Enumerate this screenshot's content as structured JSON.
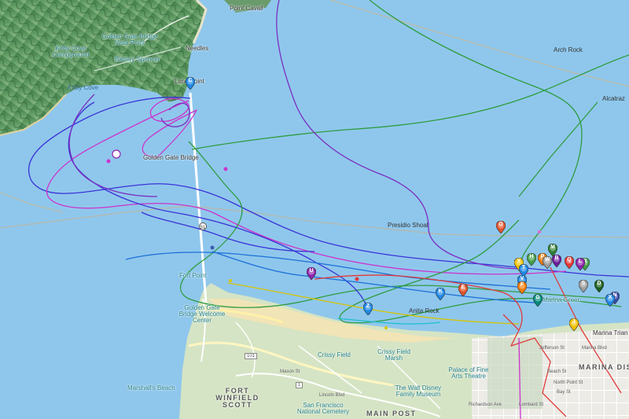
{
  "labels": {
    "point_cavallo": "Point Cavall",
    "golden_gate_bridge_vista_point": "Golden Gate Bridge Vista Point",
    "kirby_cove_campground": "Kirby Cove Campground",
    "battery_spencer": "Battery Spencer",
    "needles": "Needles",
    "lime_point": "Lime Point",
    "kirby_cove": "Kirby Cove",
    "arch_rock": "Arch Rock",
    "alcatraz": "Alcatraz",
    "golden_gate_bridge": "Golden Gate Bridge",
    "presidio_shoal": "Presidio Shoal",
    "fort_point": "Fort Point",
    "gg_welcome_center": "Golden Gate Bridge Welcome Center",
    "anita_rock": "Anita Rock",
    "marina_green": "Marina Green",
    "crissy_field": "Crissy Field",
    "crissy_field_marsh": "Crissy Field Marsh",
    "walt_disney_museum": "The Walt Disney Family Museum",
    "palace_fine_arts": "Palace of Fine Arts Theatre",
    "marshalls_beach": "Marshall's Beach",
    "fort_winfield_scott": "FORT WINFIELD SCOTT",
    "sf_national_cemetery": "San Francisco National Cemetery",
    "main_post": "MAIN POST",
    "marina_district": "MARINA DISTRI",
    "marina_triangle": "Marina Trian",
    "highway_101": "101",
    "highway_1": "1"
  },
  "roads": [
    "Mason St",
    "Lincoln Blvd",
    "Beach St",
    "North Point St",
    "Bay St",
    "Jefferson St",
    "Marina Blvd",
    "Richardson Ave",
    "Lombard St"
  ],
  "markers": [
    {
      "letter": "O",
      "color": "#e2532b"
    },
    {
      "letter": "Y",
      "color": "#f2c200"
    },
    {
      "letter": "H",
      "color": "#43a047"
    },
    {
      "letter": "P",
      "color": "#f57c00"
    },
    {
      "letter": "M",
      "color": "#2e7d32"
    },
    {
      "letter": "W",
      "color": "#9e9e9e"
    },
    {
      "letter": "B",
      "color": "#6a1b9a"
    },
    {
      "letter": "Q",
      "color": "#e53935"
    },
    {
      "letter": "R",
      "color": "#43a047"
    },
    {
      "letter": "D",
      "color": "#1b5e20"
    },
    {
      "letter": "E",
      "color": "#e2532b"
    },
    {
      "letter": "S",
      "color": "#9e9e9e"
    },
    {
      "letter": "T",
      "color": "#1e88e5"
    },
    {
      "letter": "J",
      "color": "#f2c200"
    },
    {
      "letter": "V",
      "color": "#1e88e5"
    },
    {
      "letter": "L",
      "color": "#8e24aa"
    },
    {
      "letter": "N",
      "color": "#3949ab"
    },
    {
      "letter": "F",
      "color": "#f57c00"
    },
    {
      "letter": "G",
      "color": "#00897b"
    },
    {
      "letter": "K",
      "color": "#1e88e5"
    },
    {
      "letter": "U",
      "color": "#8e24aa"
    },
    {
      "letter": "Z",
      "color": "#1e88e5"
    },
    {
      "letter": "C",
      "color": "#1e88e5"
    },
    {
      "letter": "X",
      "color": "#1e88e5"
    }
  ],
  "track_colors": [
    "#3a33d6",
    "#cc33cc",
    "#2e9c3e",
    "#7a2fc0",
    "#1b6fd8",
    "#e23a3a",
    "#d6c400",
    "#1dbfcf"
  ],
  "colors": {
    "water": "#8fc7ec",
    "land_marin": "#5a8f5f",
    "land_sf": "#d7e6c6",
    "beach": "#f2e4b5"
  }
}
